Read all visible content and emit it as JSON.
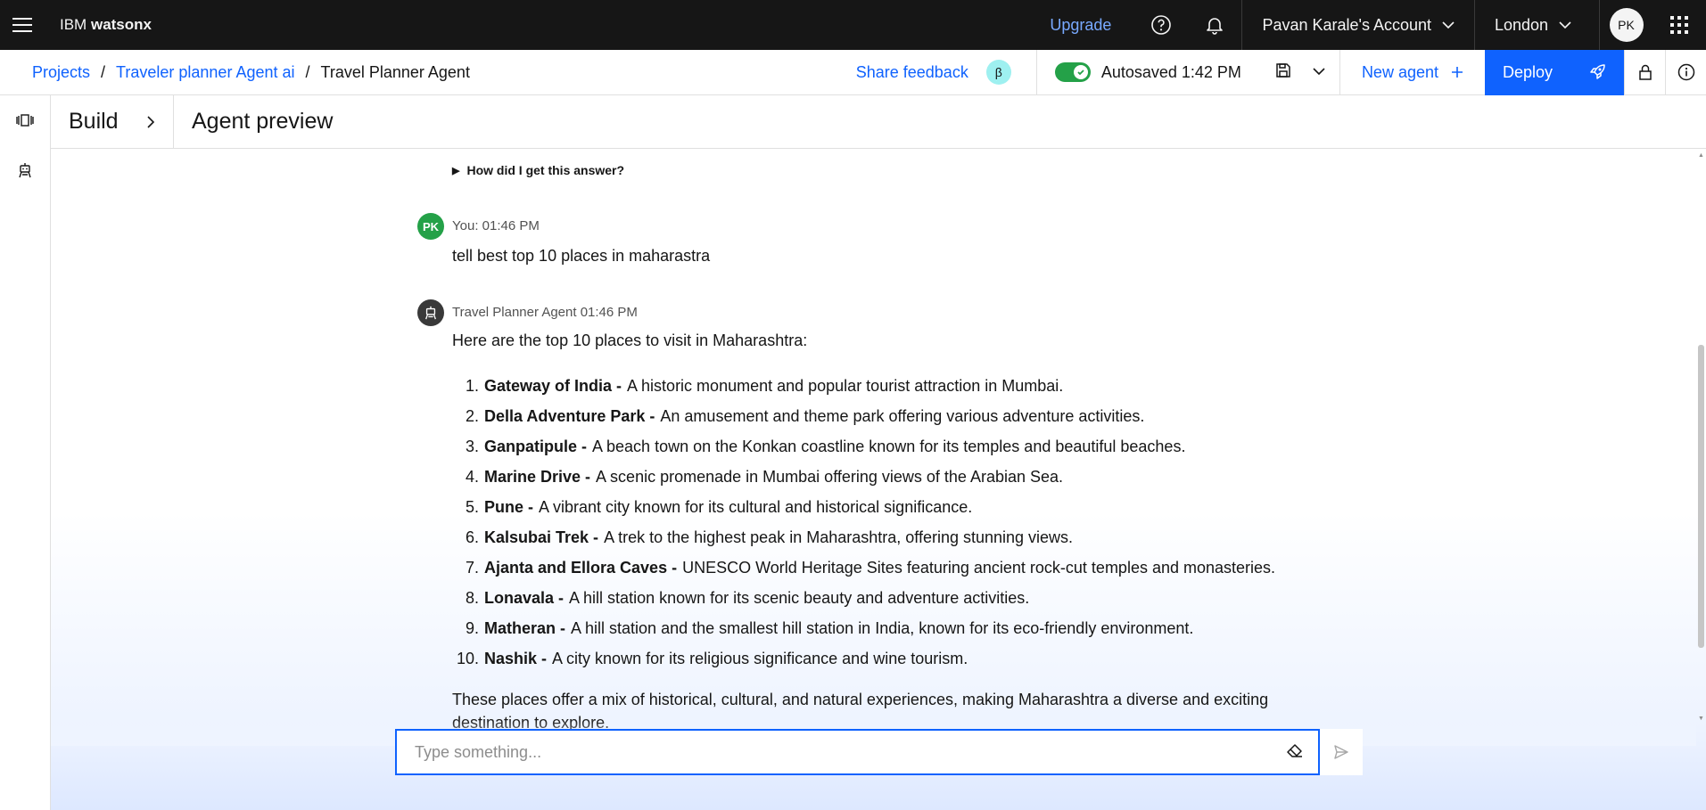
{
  "header": {
    "brand_prefix": "IBM",
    "brand_name": "watsonx",
    "upgrade": "Upgrade",
    "account": "Pavan Karale's Account",
    "region": "London",
    "avatar_initials": "PK"
  },
  "breadcrumb": {
    "items": [
      "Projects",
      "Traveler planner Agent ai",
      "Travel Planner Agent"
    ],
    "separator": "/"
  },
  "toolbar": {
    "share_feedback": "Share feedback",
    "beta": "β",
    "autosaved": "Autosaved 1:42 PM",
    "new_agent": "New agent",
    "deploy": "Deploy"
  },
  "titlebar": {
    "build": "Build",
    "preview": "Agent preview"
  },
  "chat": {
    "how_label": "How did I get this answer?",
    "user_initials": "PK",
    "user_meta": "You: 01:46 PM",
    "user_message": "tell best top 10 places in maharastra",
    "agent_meta": "Travel Planner Agent 01:46 PM",
    "agent_intro": "Here are the top 10 places to visit in Maharashtra:",
    "places": [
      {
        "num": "1.",
        "name": "Gateway of India -",
        "desc": "A historic monument and popular tourist attraction in Mumbai."
      },
      {
        "num": "2.",
        "name": "Della Adventure Park -",
        "desc": "An amusement and theme park offering various adventure activities."
      },
      {
        "num": "3.",
        "name": "Ganpatipule -",
        "desc": "A beach town on the Konkan coastline known for its temples and beautiful beaches."
      },
      {
        "num": "4.",
        "name": "Marine Drive -",
        "desc": "A scenic promenade in Mumbai offering views of the Arabian Sea."
      },
      {
        "num": "5.",
        "name": "Pune -",
        "desc": "A vibrant city known for its cultural and historical significance."
      },
      {
        "num": "6.",
        "name": "Kalsubai Trek -",
        "desc": "A trek to the highest peak in Maharashtra, offering stunning views."
      },
      {
        "num": "7.",
        "name": "Ajanta and Ellora Caves -",
        "desc": "UNESCO World Heritage Sites featuring ancient rock-cut temples and monasteries."
      },
      {
        "num": "8.",
        "name": "Lonavala -",
        "desc": "A hill station known for its scenic beauty and adventure activities."
      },
      {
        "num": "9.",
        "name": "Matheran -",
        "desc": "A hill station and the smallest hill station in India, known for its eco-friendly environment."
      },
      {
        "num": "10.",
        "name": "Nashik -",
        "desc": "A city known for its religious significance and wine tourism."
      }
    ],
    "agent_closing": "These places offer a mix of historical, cultural, and natural experiences, making Maharashtra a diverse and exciting destination to explore."
  },
  "input": {
    "placeholder": "Type something..."
  },
  "colors": {
    "primary": "#0f62fe",
    "header_bg": "#161616",
    "toggle_on": "#24a148",
    "beta_badge": "#9ef0f0",
    "user_avatar": "#24a148",
    "bot_avatar": "#393939"
  }
}
